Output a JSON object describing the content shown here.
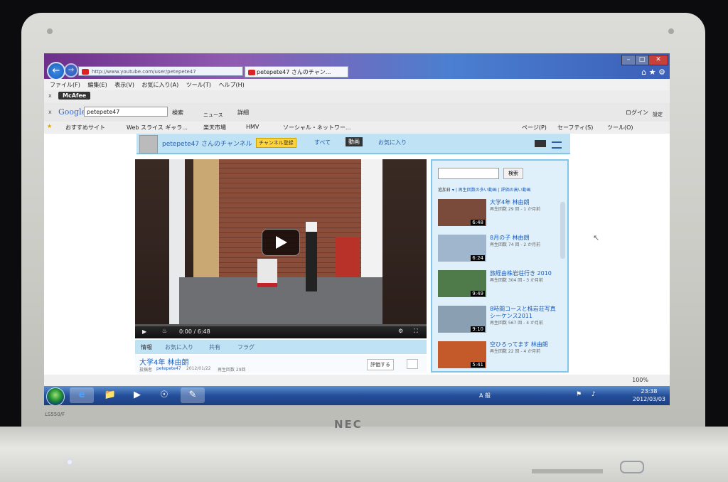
{
  "device": {
    "brand": "NEC",
    "model_badge": "LS550/F"
  },
  "browser": {
    "address": "http://www.youtube.com/user/petepete47",
    "tab_title": "petepete47 さんのチャン...",
    "menu": [
      "ファイル(F)",
      "編集(E)",
      "表示(V)",
      "お気に入り(A)",
      "ツール(T)",
      "ヘルプ(H)"
    ],
    "mcafee_label": "McAfee",
    "google_logo": "Google",
    "google_query": "petepete47",
    "google_search_label": "検索",
    "google_news_label": "ニュース",
    "google_more_label": "詳細",
    "login_label": "ログイン",
    "settings_label": "設定",
    "favorites": [
      "おすすめサイト",
      "Web スライス ギャラ...",
      "楽天市場",
      "HMV",
      "ソーシャル・ネットワー..."
    ],
    "command_items": [
      "ページ(P)",
      "セーフティ(S)",
      "ツール(O)"
    ],
    "zoom": "100%"
  },
  "channel": {
    "name": "petepete47 さんのチャンネル",
    "subscribe": "チャンネル登録",
    "tabs": [
      "すべて",
      "動画",
      "お気に入り"
    ],
    "active_tab": "動画"
  },
  "player": {
    "time": "0:00 / 6:48",
    "info_tabs": [
      "情報",
      "お気に入り",
      "共有",
      "フラグ"
    ],
    "video_title": "大学4年 林由朗",
    "meta_uploader_label": "投稿者",
    "meta_uploader": "petepete47",
    "meta_date": "2012/01/22",
    "meta_views": "再生回数 29回",
    "rate_label": "評価する"
  },
  "sidebar": {
    "search_button": "検索",
    "sort": {
      "active": "追加日",
      "others": [
        "再生回数の多い動画",
        "評価の高い動画"
      ]
    },
    "videos": [
      {
        "title": "大学4年 林由朗",
        "meta": "再生回数 29 回 - 1 か月前",
        "duration": "6:48",
        "thumb": "#7a4a3a"
      },
      {
        "title": "8月の子 林由朗",
        "meta": "再生回数 74 回 - 2 か月前",
        "duration": "6:24",
        "thumb": "#9fb6cc"
      },
      {
        "title": "旅経由株岩荘行き 2010",
        "meta": "再生回数 304 回 - 3 か月前",
        "duration": "9:49",
        "thumb": "#4f7a4a"
      },
      {
        "title": "8時間コースと株岩荘写真シーケンス2011",
        "meta": "再生回数 567 回 - 4 か月前",
        "duration": "9:10",
        "thumb": "#8aa0b2"
      },
      {
        "title": "空ひろってます 林由朗",
        "meta": "再生回数 22 回 - 4 か月前",
        "duration": "5:41",
        "thumb": "#c45a2a"
      }
    ]
  },
  "taskbar": {
    "time": "23:38",
    "date": "2012/03/03",
    "tray_label": "A 般"
  }
}
